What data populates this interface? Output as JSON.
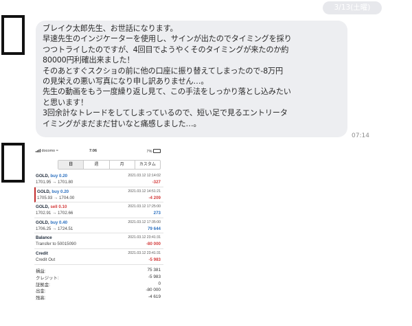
{
  "chat": {
    "date": "3/13(土曜)",
    "time": "07:14",
    "message_lines": [
      "ブレイク太郎先生、お世話になります。",
      "早速先生のインジケーターを使用し、サインが出たのでタイミングを採り",
      "つつトライしたのですが、4回目でようやくそのタイミングが来たのか約",
      "80000円利確出来ました！",
      "そのあとすぐスクショの前に他の口座に振り替えてしまったので-8万円",
      "の見栄えの悪い写真になり申し訳ありません…。",
      "先生の動画をもう一度繰り返し見て、この手法をしっかり落とし込みたい",
      "と思います！",
      "3回余計なトレードをしてしまっているので、短い足で見るエントリータ",
      "イミングがまだまだ甘いなと痛感しました…。"
    ]
  },
  "screenshot": {
    "status": {
      "carrier": "docomo",
      "clock": "7:06",
      "battery": "7%"
    },
    "tabs": [
      "日",
      "週",
      "月",
      "カスタム"
    ],
    "active_tab": "日",
    "trades": [
      {
        "symbol": "GOLD,",
        "direction": "buy 0.20",
        "side": "buy",
        "prices": "1701.95 → 1701.80",
        "datetime": "2021.03.12 12:14:02",
        "result": "-327",
        "sign": "neg"
      },
      {
        "symbol": "GOLD,",
        "direction": "buy 0.20",
        "side": "buy",
        "prices": "1705.93 → 1704.00",
        "datetime": "2021.03.12 14:51:21",
        "result": "-4 209",
        "sign": "neg"
      },
      {
        "symbol": "GOLD,",
        "direction": "sell 0.10",
        "side": "sell",
        "prices": "1702.91 → 1702.66",
        "datetime": "2021.03.12 17:25:00",
        "result": "273",
        "sign": "pos"
      },
      {
        "symbol": "GOLD,",
        "direction": "buy 0.40",
        "side": "buy",
        "prices": "1706.25 → 1724.51",
        "datetime": "2021.03.12 17:35:00",
        "result": "79 644",
        "sign": "pos"
      },
      {
        "symbol": "Balance",
        "direction": "",
        "side": "",
        "prices": "Transfer to 50015090",
        "datetime": "2021.03.12 23:41:31",
        "result": "-80 000",
        "sign": "neg"
      },
      {
        "symbol": "Credit",
        "direction": "",
        "side": "",
        "prices": "Credit Out",
        "datetime": "2021.03.12 23:41:31",
        "result": "-5 983",
        "sign": "neg"
      }
    ],
    "summary": [
      {
        "label": "損益:",
        "value": "75 381"
      },
      {
        "label": "クレジット:",
        "value": "-5 983"
      },
      {
        "label": "証拠金:",
        "value": "0"
      },
      {
        "label": "出金:",
        "value": "-80 000"
      },
      {
        "label": "残高:",
        "value": "-4 619"
      }
    ]
  },
  "colors": {
    "bubble": "#edeef1",
    "negative": "#d33a3a",
    "positive": "#2a6fbf",
    "date_pill": "#e7e8ec"
  },
  "icons": {
    "avatar": "avatar-placeholder",
    "signal": "signal-icon",
    "battery": "battery-icon"
  }
}
